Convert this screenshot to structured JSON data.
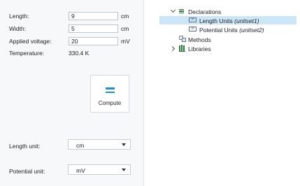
{
  "form": {
    "length": {
      "label": "Length:",
      "value": "9",
      "unit": "cm"
    },
    "width": {
      "label": "Width:",
      "value": "5",
      "unit": "cm"
    },
    "voltage": {
      "label": "Applied voltage:",
      "value": "20",
      "unit": "mV"
    },
    "temperature": {
      "label": "Temperature:",
      "value": "330.4 K"
    }
  },
  "compute": {
    "label": "Compute",
    "icon": "equals-icon",
    "color": "#1f8fcf"
  },
  "length_unit": {
    "label": "Length unit:",
    "selected": "cm"
  },
  "potential_unit": {
    "label": "Potential unit:",
    "selected": "mV"
  },
  "tree": {
    "declarations": {
      "label": "Declarations"
    },
    "length_units": {
      "label": "Length Units",
      "tag": "(unitset1)"
    },
    "potential_units": {
      "label": "Potential Units",
      "tag": "(unitset2)"
    },
    "methods": {
      "label": "Methods"
    },
    "libraries": {
      "label": "Libraries"
    }
  },
  "colors": {
    "selection": "#cde6f7",
    "accent": "#1f8fcf"
  }
}
